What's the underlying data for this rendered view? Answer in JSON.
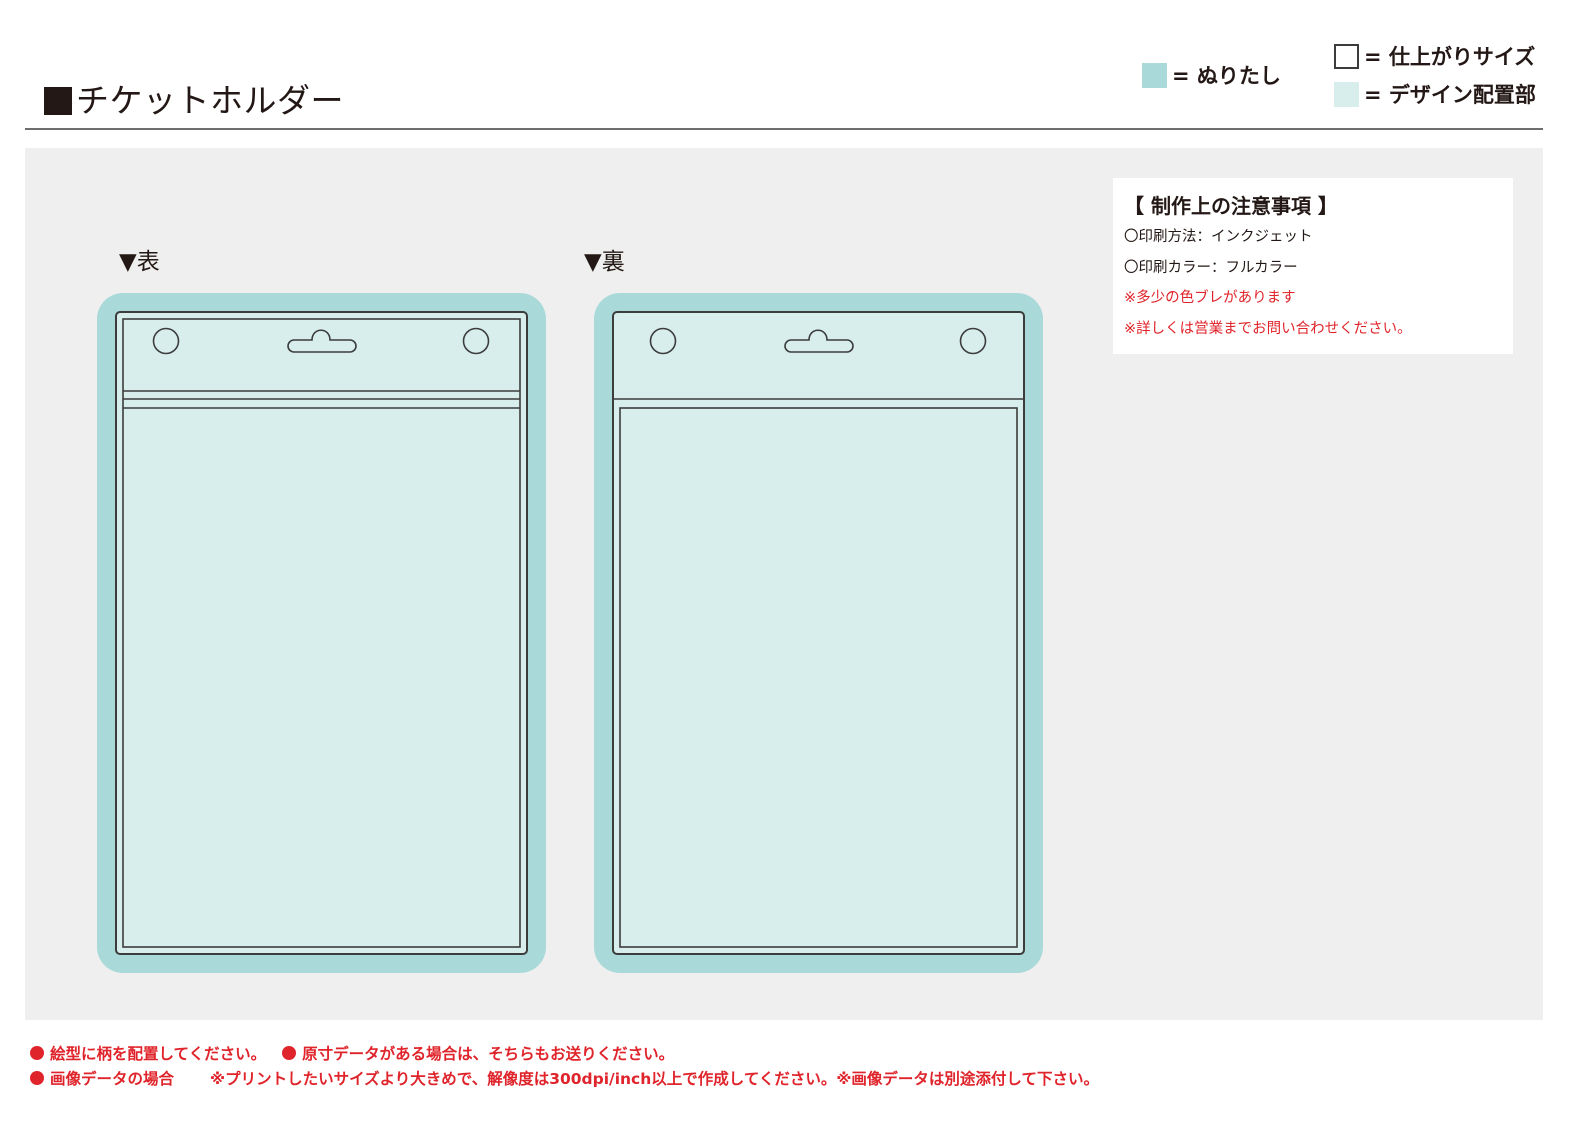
{
  "header": {
    "title": "チケットホルダー"
  },
  "legend": {
    "bleed_label": "= ぬりたし",
    "trim_label": "= 仕上がりサイズ",
    "design_label": "= デザイン配置部"
  },
  "sides": {
    "front_label": "▼表",
    "back_label": "▼裏"
  },
  "notes": {
    "heading": "【 制作上の注意事項 】",
    "lines": [
      "〇印刷方法：インクジェット",
      "〇印刷カラー：フルカラー",
      "※多少の色ブレがあります",
      "※詳しくは営業までお問い合わせください。"
    ]
  },
  "footer": {
    "line1_a": "絵型に柄を配置してください。",
    "line1_b": "原寸データがある場合は、そちらもお送りください。",
    "line2_a": "画像データの場合",
    "line2_b": "※プリントしたいサイズより大きめで、解像度は300dpi/inch以上で作成してください。※画像データは別途添付して下さい。"
  },
  "colors": {
    "bleed": "#a9dad9",
    "design": "#d7eeec",
    "outline": "#3c3c3c",
    "canvas": "#eeefee",
    "warning_red": "#e0242b"
  }
}
